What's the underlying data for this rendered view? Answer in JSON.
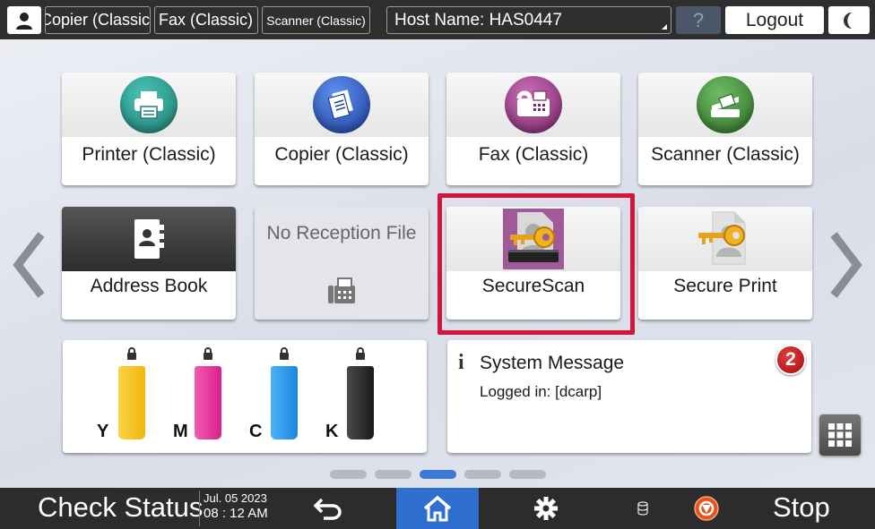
{
  "topbar": {
    "user_icon": "user-icon",
    "copier_label": "Copier (Classic)",
    "fax_label": "Fax (Classic)",
    "scanner_label": "Scanner (Classic)",
    "host_name": "Host Name: HAS0447",
    "help_label": "?",
    "logout_label": "Logout",
    "sleep_icon": "moon-icon"
  },
  "apps": {
    "printer": {
      "label": "Printer (Classic)",
      "icon": "printer-icon",
      "color": "#2a9d8f"
    },
    "copier": {
      "label": "Copier (Classic)",
      "icon": "copier-icon",
      "color": "#2f5fc4"
    },
    "fax": {
      "label": "Fax (Classic)",
      "icon": "fax-icon",
      "color": "#a0428f"
    },
    "scanner": {
      "label": "Scanner (Classic)",
      "icon": "scanner-icon",
      "color": "#3f8f3a"
    },
    "address_book": {
      "label": "Address Book",
      "icon": "address-book-icon"
    },
    "no_reception": {
      "label": "No Reception File",
      "icon": "fax-machine-icon"
    },
    "secure_scan": {
      "label": "SecureScan",
      "icon": "secure-scan-key-icon"
    },
    "secure_print": {
      "label": "Secure Print",
      "icon": "secure-print-key-icon"
    }
  },
  "toner": {
    "cartridges": [
      {
        "letter": "Y",
        "color": "#f6c21a"
      },
      {
        "letter": "M",
        "color": "#e8399f"
      },
      {
        "letter": "C",
        "color": "#2b9af0"
      },
      {
        "letter": "K",
        "color": "#2a2a2a"
      }
    ]
  },
  "system_message": {
    "info_icon": "i",
    "title": "System Message",
    "subtitle": "Logged in: [dcarp]",
    "badge_count": "2"
  },
  "pagination": {
    "total": 5,
    "active": 3
  },
  "bottombar": {
    "check_status": "Check Status",
    "date": "Jul. 05 2023",
    "time": "08 : 12 AM",
    "stop_label": "Stop"
  },
  "colors": {
    "highlight": "#d4143a",
    "home_active": "#2f6fd0"
  }
}
